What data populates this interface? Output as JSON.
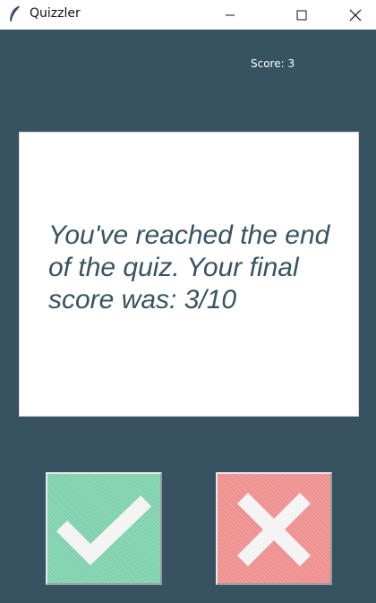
{
  "window": {
    "title": "Quizzler",
    "icons": {
      "app": "feather-icon",
      "minimize": "minimize-icon",
      "maximize": "maximize-icon",
      "close": "close-icon"
    }
  },
  "score": {
    "label": "Score: 3"
  },
  "card": {
    "text": "You've reached the end of the quiz. Your final score was: 3/10"
  },
  "buttons": {
    "true_icon": "check-icon",
    "false_icon": "cross-icon"
  },
  "colors": {
    "background": "#375362",
    "card": "#ffffff",
    "true_button": "#7fd1ad",
    "false_button": "#ef8f8f",
    "text": "#375362"
  }
}
